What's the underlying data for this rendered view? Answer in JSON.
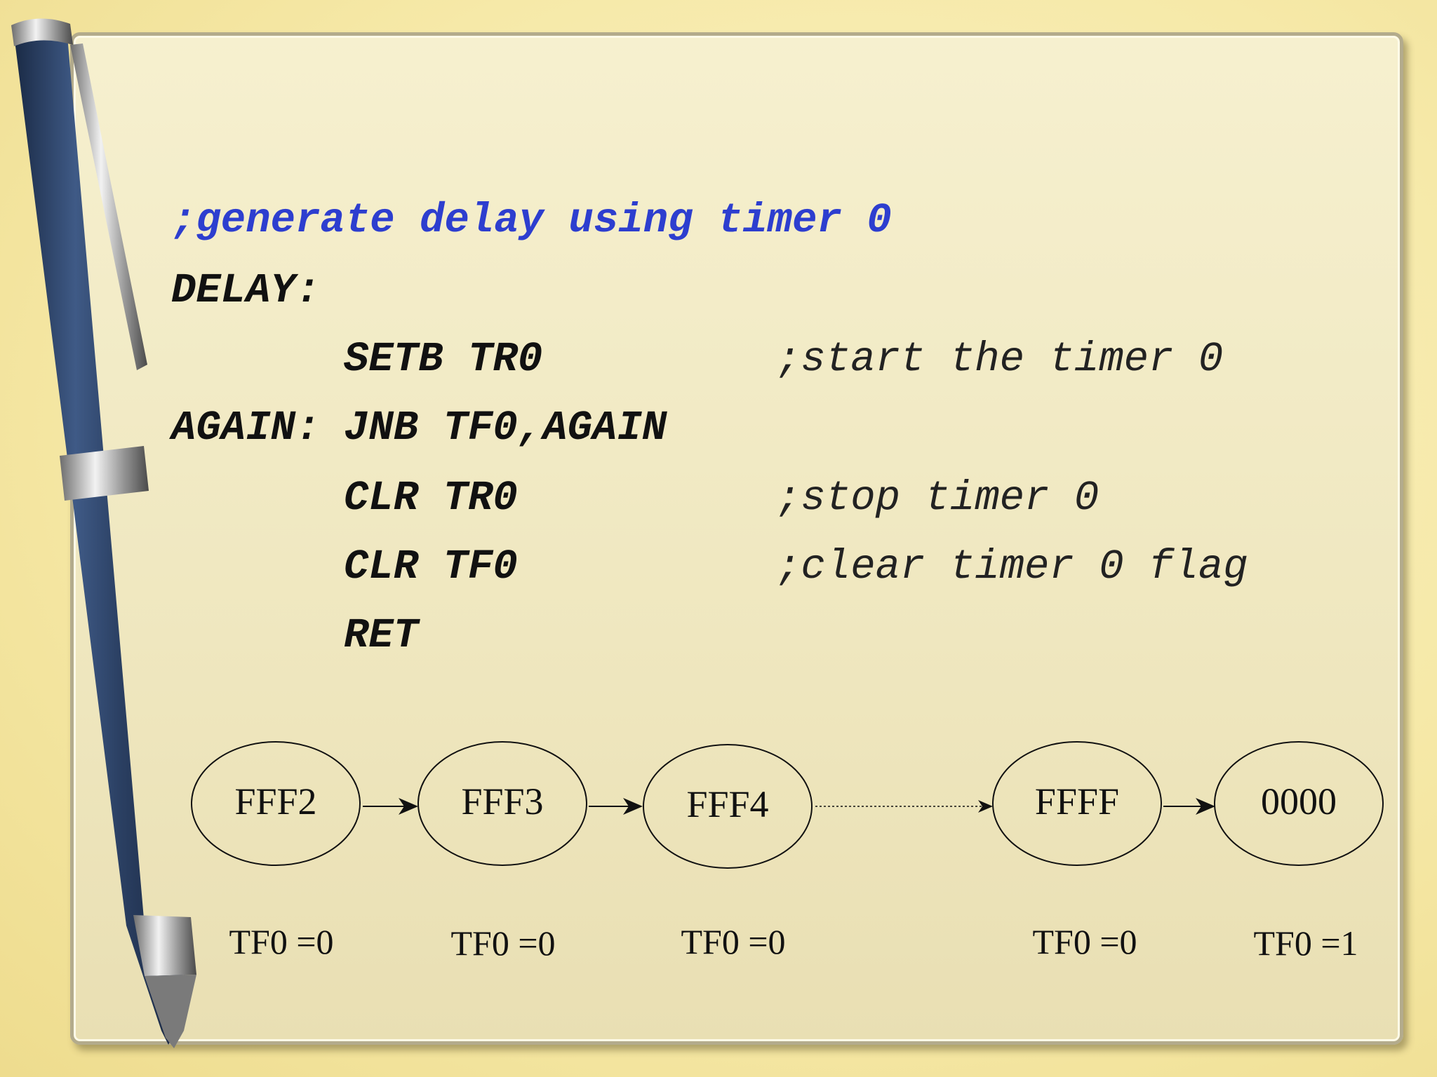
{
  "code": {
    "header_comment": ";generate delay using timer 0",
    "lines": [
      {
        "label": "DELAY:",
        "instr": "",
        "comment": ""
      },
      {
        "label": "",
        "instr": "SETB TR0",
        "comment": ";start the timer 0"
      },
      {
        "label": "AGAIN:",
        "instr": "JNB TF0,AGAIN",
        "comment": ""
      },
      {
        "label": "",
        "instr": "CLR TR0",
        "comment": ";stop timer 0"
      },
      {
        "label": "",
        "instr": "CLR TF0",
        "comment": ";clear timer 0 flag"
      },
      {
        "label": "",
        "instr": "RET",
        "comment": ""
      }
    ]
  },
  "diagram": {
    "states": [
      "FFF2",
      "FFF3",
      "FFF4",
      "FFFF",
      "0000"
    ],
    "flags": [
      "TF0 =0",
      "TF0 =0",
      "TF0 =0",
      "TF0 =0",
      "TF0 =1"
    ]
  },
  "colors": {
    "comment_blue": "#2d3ecf",
    "pen_blue": "#2b4063"
  }
}
